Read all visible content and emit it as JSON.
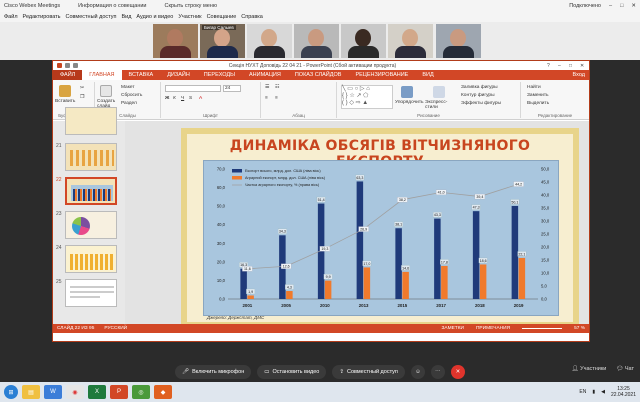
{
  "webex": {
    "title": "Cisco Webex Meetings",
    "tab1": "Информация о совещании",
    "tab2": "Скрыть строку меню",
    "connected": "Подключено",
    "menu": [
      "Файл",
      "Редактировать",
      "Совместный доступ",
      "Вид",
      "Аудио и видео",
      "Участник",
      "Совещание",
      "Справка"
    ],
    "participant_name": "Бигар Салыев"
  },
  "ppt": {
    "window_title": "Секція НУХТ Доповідь 22 04 21 - PowerPoint (Сбой активации продукта)",
    "tabs": [
      "ФАЙЛ",
      "ГЛАВНАЯ",
      "ВСТАВКА",
      "ДИЗАЙН",
      "ПЕРЕХОДЫ",
      "АНИМАЦИЯ",
      "ПОКАЗ СЛАЙДОВ",
      "РЕЦЕНЗИРОВАНИЕ",
      "ВИД"
    ],
    "account": "Вход",
    "ribbon": {
      "paste": "Вставить",
      "new_slide": "Создать слайд",
      "layout": "Макет",
      "reset": "Сбросить",
      "section": "Раздел",
      "font_size": "24",
      "arrange": "Упорядочить",
      "styles": "Экспресс-стили",
      "fill": "Заливка фигуры",
      "outline": "Контур фигуры",
      "effects": "Эффекты фигуры",
      "find": "Найти",
      "replace": "Заменить",
      "select": "Выделить",
      "groups": {
        "clipboard": "Буфер обмена",
        "slides": "Слайды",
        "font": "Шрифт",
        "paragraph": "Абзац",
        "drawing": "Рисование",
        "editing": "Редактирование"
      }
    },
    "slide_numbers": [
      "21",
      "22",
      "23",
      "24",
      "25"
    ],
    "status": {
      "slide": "СЛАЙД 22 ИЗ 95",
      "lang": "РУССКИЙ",
      "notes": "ЗАМЕТКИ",
      "comments": "ПРИМЕЧАНИЯ",
      "zoom": "57 %"
    }
  },
  "slide": {
    "title": "ДИНАМІКА ОБСЯГІВ ВІТЧИЗНЯНОГО ЕКСПОРТУ",
    "source": "Джерело: Держстат, ДМС"
  },
  "chart_data": {
    "type": "bar",
    "categories": [
      "2001",
      "2005",
      "2010",
      "2013",
      "2015",
      "2017",
      "2018",
      "2019"
    ],
    "series": [
      {
        "name": "Експорт всього, млрд. дол. США (ліва вісь)",
        "values": [
          16.3,
          34.3,
          51.4,
          63.3,
          38.1,
          43.3,
          47.3,
          50.1
        ],
        "color": "#1f3a7a"
      },
      {
        "name": "Аграрний експорт, млрд. дол. США (ліва вісь)",
        "values": [
          1.9,
          4.3,
          9.9,
          17.0,
          14.6,
          17.8,
          18.6,
          22.1
        ],
        "color": "#f07a2c"
      },
      {
        "name": "Частка аграрного експорту, % (права вісь)",
        "values": [
          11.6,
          12.6,
          19.3,
          26.9,
          38.2,
          41.0,
          39.4,
          44.2
        ],
        "color": "#a0a0a0",
        "kind": "line",
        "axis": "right"
      }
    ],
    "ylim": [
      0,
      70
    ],
    "ylim_right": [
      0,
      50
    ],
    "yticks": [
      "0,0",
      "10,0",
      "20,0",
      "30,0",
      "40,0",
      "50,0",
      "60,0",
      "70,0"
    ],
    "yticks_right": [
      "0,0",
      "5,0",
      "10,0",
      "15,0",
      "20,0",
      "25,0",
      "30,0",
      "35,0",
      "40,0",
      "45,0",
      "50,0"
    ],
    "legend": "top-left",
    "grid": false
  },
  "controls": {
    "mic": "Включить микрофон",
    "video": "Остановить видео",
    "share": "Совместный доступ",
    "participants": "Участники",
    "chat": "Чат"
  },
  "taskbar": {
    "lang": "EN",
    "time": "13:25",
    "date": "22.04.2021"
  },
  "colors": {
    "ppt_accent": "#d24726",
    "end_call": "#e0342c"
  }
}
